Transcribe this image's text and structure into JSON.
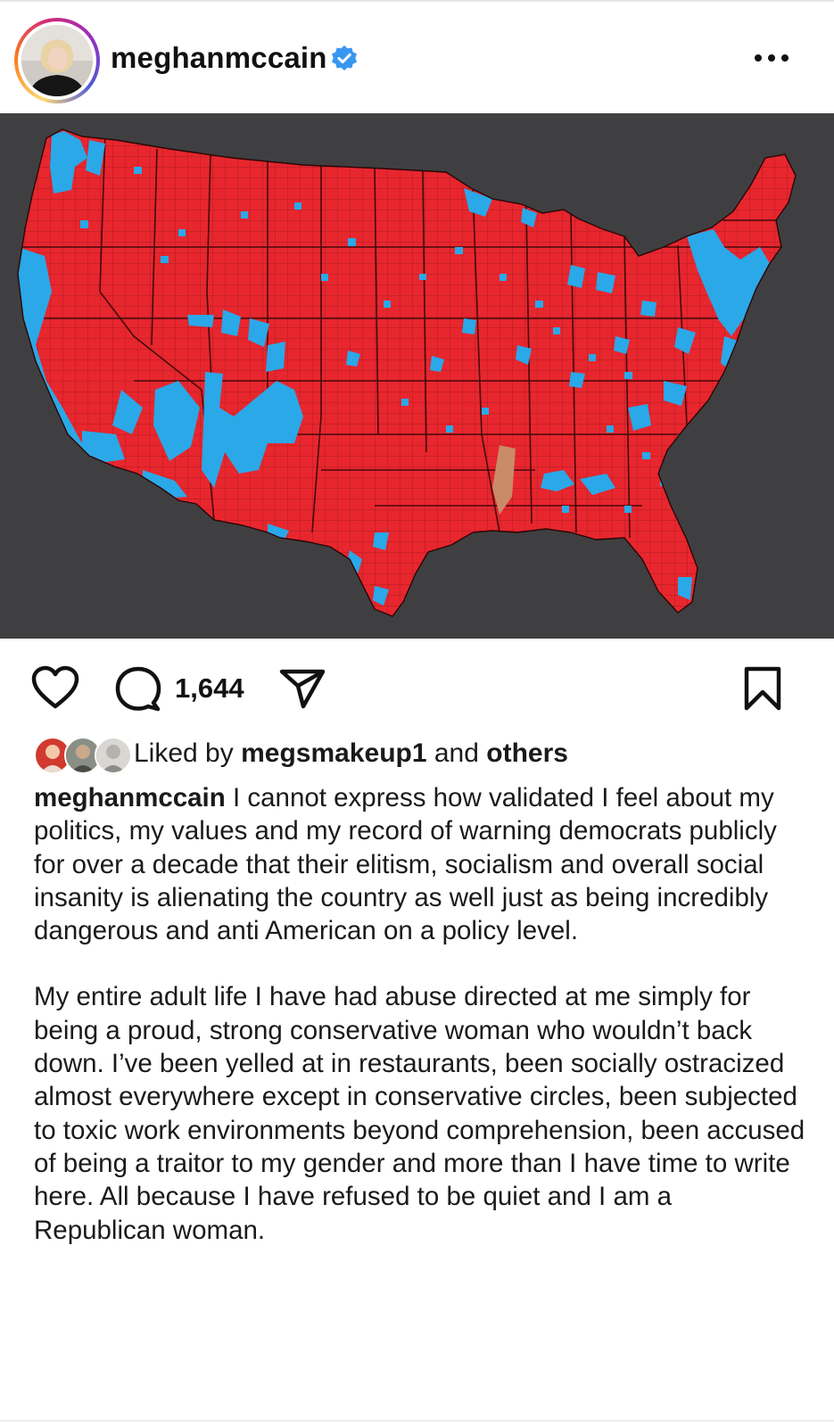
{
  "post": {
    "username": "meghanmccain",
    "verified": true,
    "menu_icon": "more-horizontal-icon"
  },
  "image": {
    "description_icon": "us-county-election-map",
    "colors": {
      "background": "#3f3f41",
      "red": "#e8262e",
      "blue": "#2aa8e8",
      "border": "#3a0a0a"
    }
  },
  "actions": {
    "comment_count": "1,644"
  },
  "likes": {
    "prefix": "Liked by",
    "user": "megsmakeup1",
    "connector": "and",
    "others": "others"
  },
  "caption": {
    "username": "meghanmccain",
    "paragraph1": "I cannot express how validated I feel about my politics, my values and my record of warning democrats publicly for over a decade that their elitism, socialism and overall social insanity is alienating the country as well just as being incredibly dangerous and anti American on a policy level.",
    "paragraph2": "My entire adult life I have had abuse directed at me simply for being a proud, strong conservative woman who wouldn’t back down. I’ve been yelled at in restaurants, been socially ostracized almost everywhere except in conservative circles, been subjected to toxic work environments beyond comprehension, been accused of being a traitor to my gender and more than I have time to write here. All because I have refused to be quiet and I am a Republican woman."
  }
}
